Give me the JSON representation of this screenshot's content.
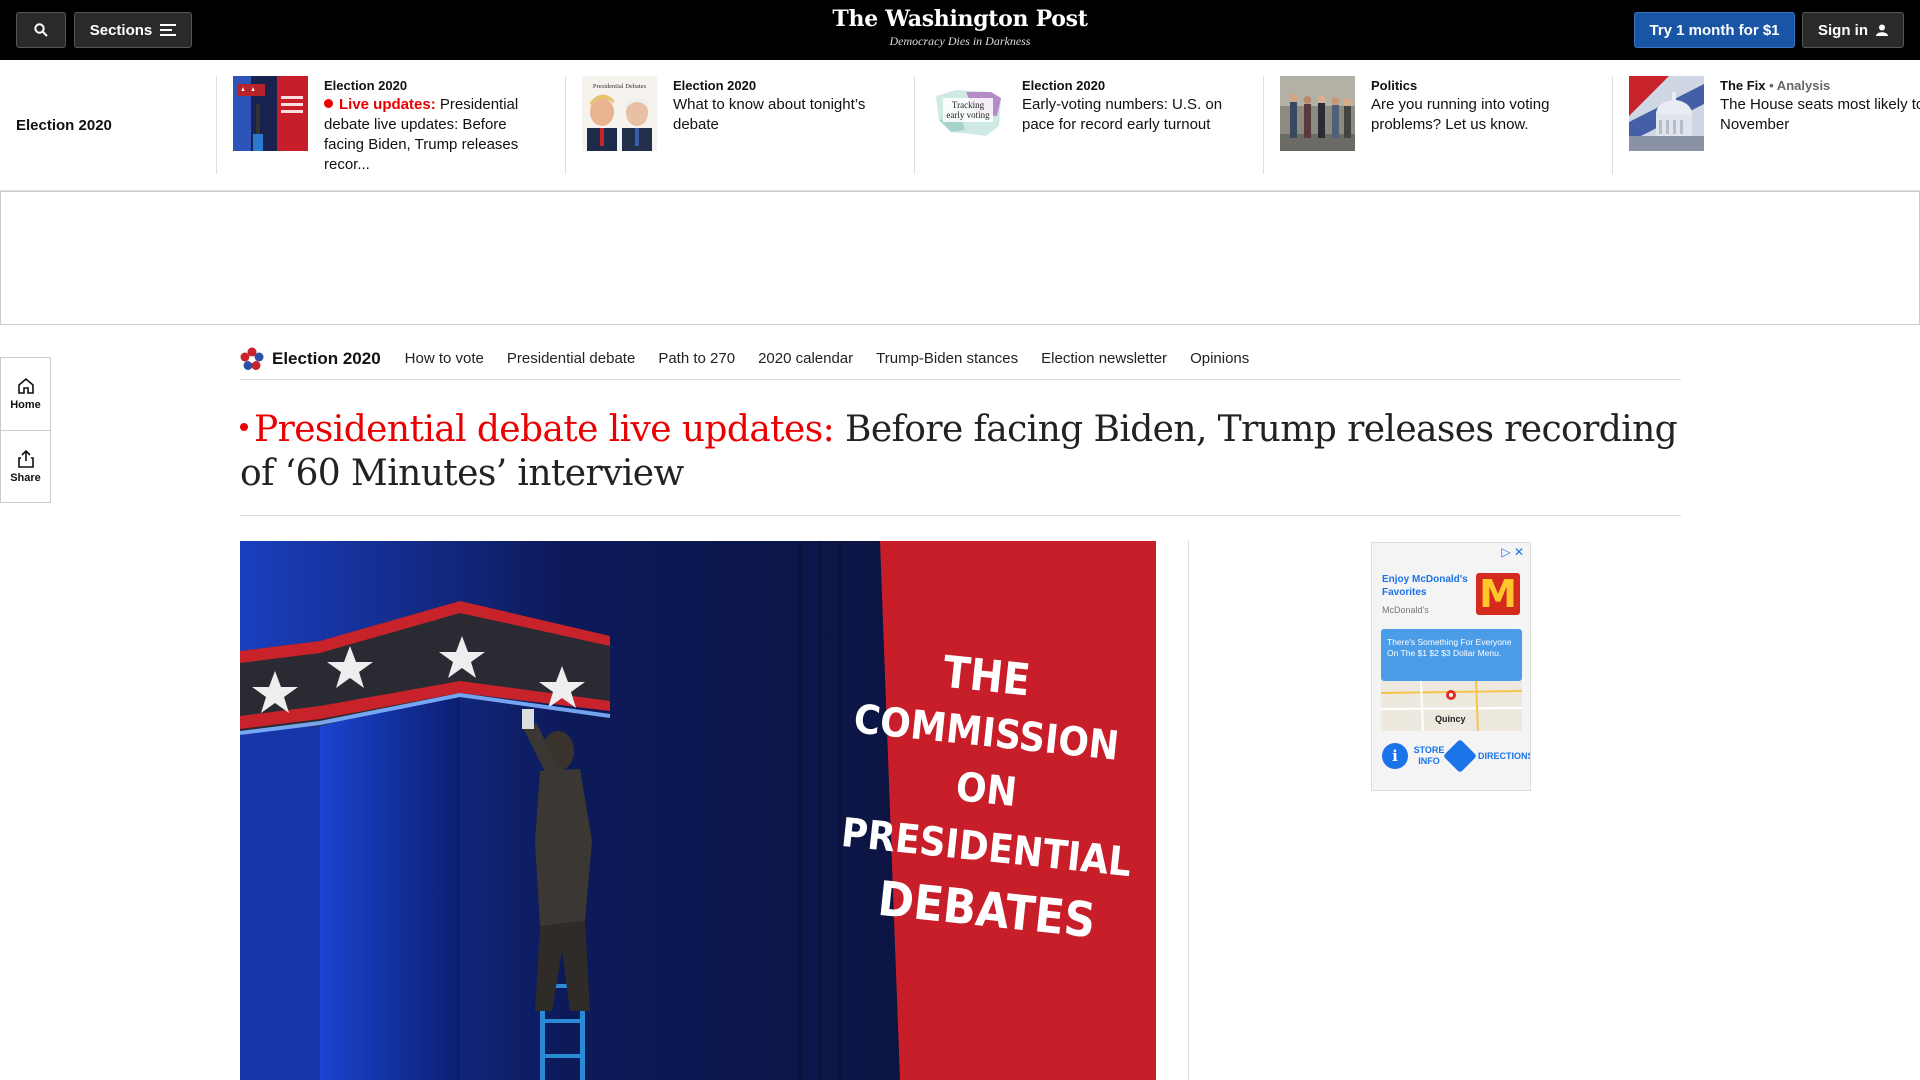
{
  "topbar": {
    "sections_label": "Sections",
    "logo_name": "The Washington Post",
    "logo_tagline": "Democracy Dies in Darkness",
    "try_label": "Try 1 month for $1",
    "signin_label": "Sign in"
  },
  "strip": {
    "label": "Election 2020",
    "cards": [
      {
        "kicker": "Election 2020",
        "kicker_sub": "",
        "live_label": "Live updates:",
        "headline": "Presidential debate live updates: Before facing Biden, Trump releases recor..."
      },
      {
        "kicker": "Election 2020",
        "kicker_sub": "",
        "live_label": "",
        "headline": "What to know about tonight’s debate"
      },
      {
        "kicker": "Election 2020",
        "kicker_sub": "",
        "live_label": "",
        "headline": "Early-voting numbers: U.S. on pace for record early turnout"
      },
      {
        "kicker": "Politics",
        "kicker_sub": "",
        "live_label": "",
        "headline": "Are you running into voting problems? Let us know."
      },
      {
        "kicker": "The Fix",
        "kicker_sub": " • Analysis",
        "live_label": "",
        "headline": "The House seats most likely to flip in November"
      }
    ],
    "thumb_texts": {
      "debates_small": "Presidential Debates",
      "tracking": "Tracking early voting"
    }
  },
  "rail": {
    "home_label": "Home",
    "share_label": "Share"
  },
  "secnav": {
    "brand": "Election 2020",
    "links": [
      "How to vote",
      "Presidential debate",
      "Path to 270",
      "2020 calendar",
      "Trump-Biden stances",
      "Election newsletter",
      "Opinions"
    ]
  },
  "headline": {
    "live": "Presidential debate live updates:",
    "rest": "Before facing Biden, Trump releases recording of ‘60 Minutes’ interview"
  },
  "photo": {
    "banner_lines": [
      "THE",
      "COMMISSION",
      "ON",
      "PRESIDENTIAL",
      "DEBATES"
    ]
  },
  "ad": {
    "title": "Enjoy McDonald's Favorites",
    "brand": "McDonald's",
    "logo": "M",
    "blurb": "There's Something For Everyone On The $1 $2 $3 Dollar Menu.",
    "city": "Quincy",
    "store_info": "STORE INFO",
    "directions": "DIRECTIONS"
  },
  "colors": {
    "accent_red": "#ea0000",
    "subscribe_blue": "#1955a5"
  }
}
